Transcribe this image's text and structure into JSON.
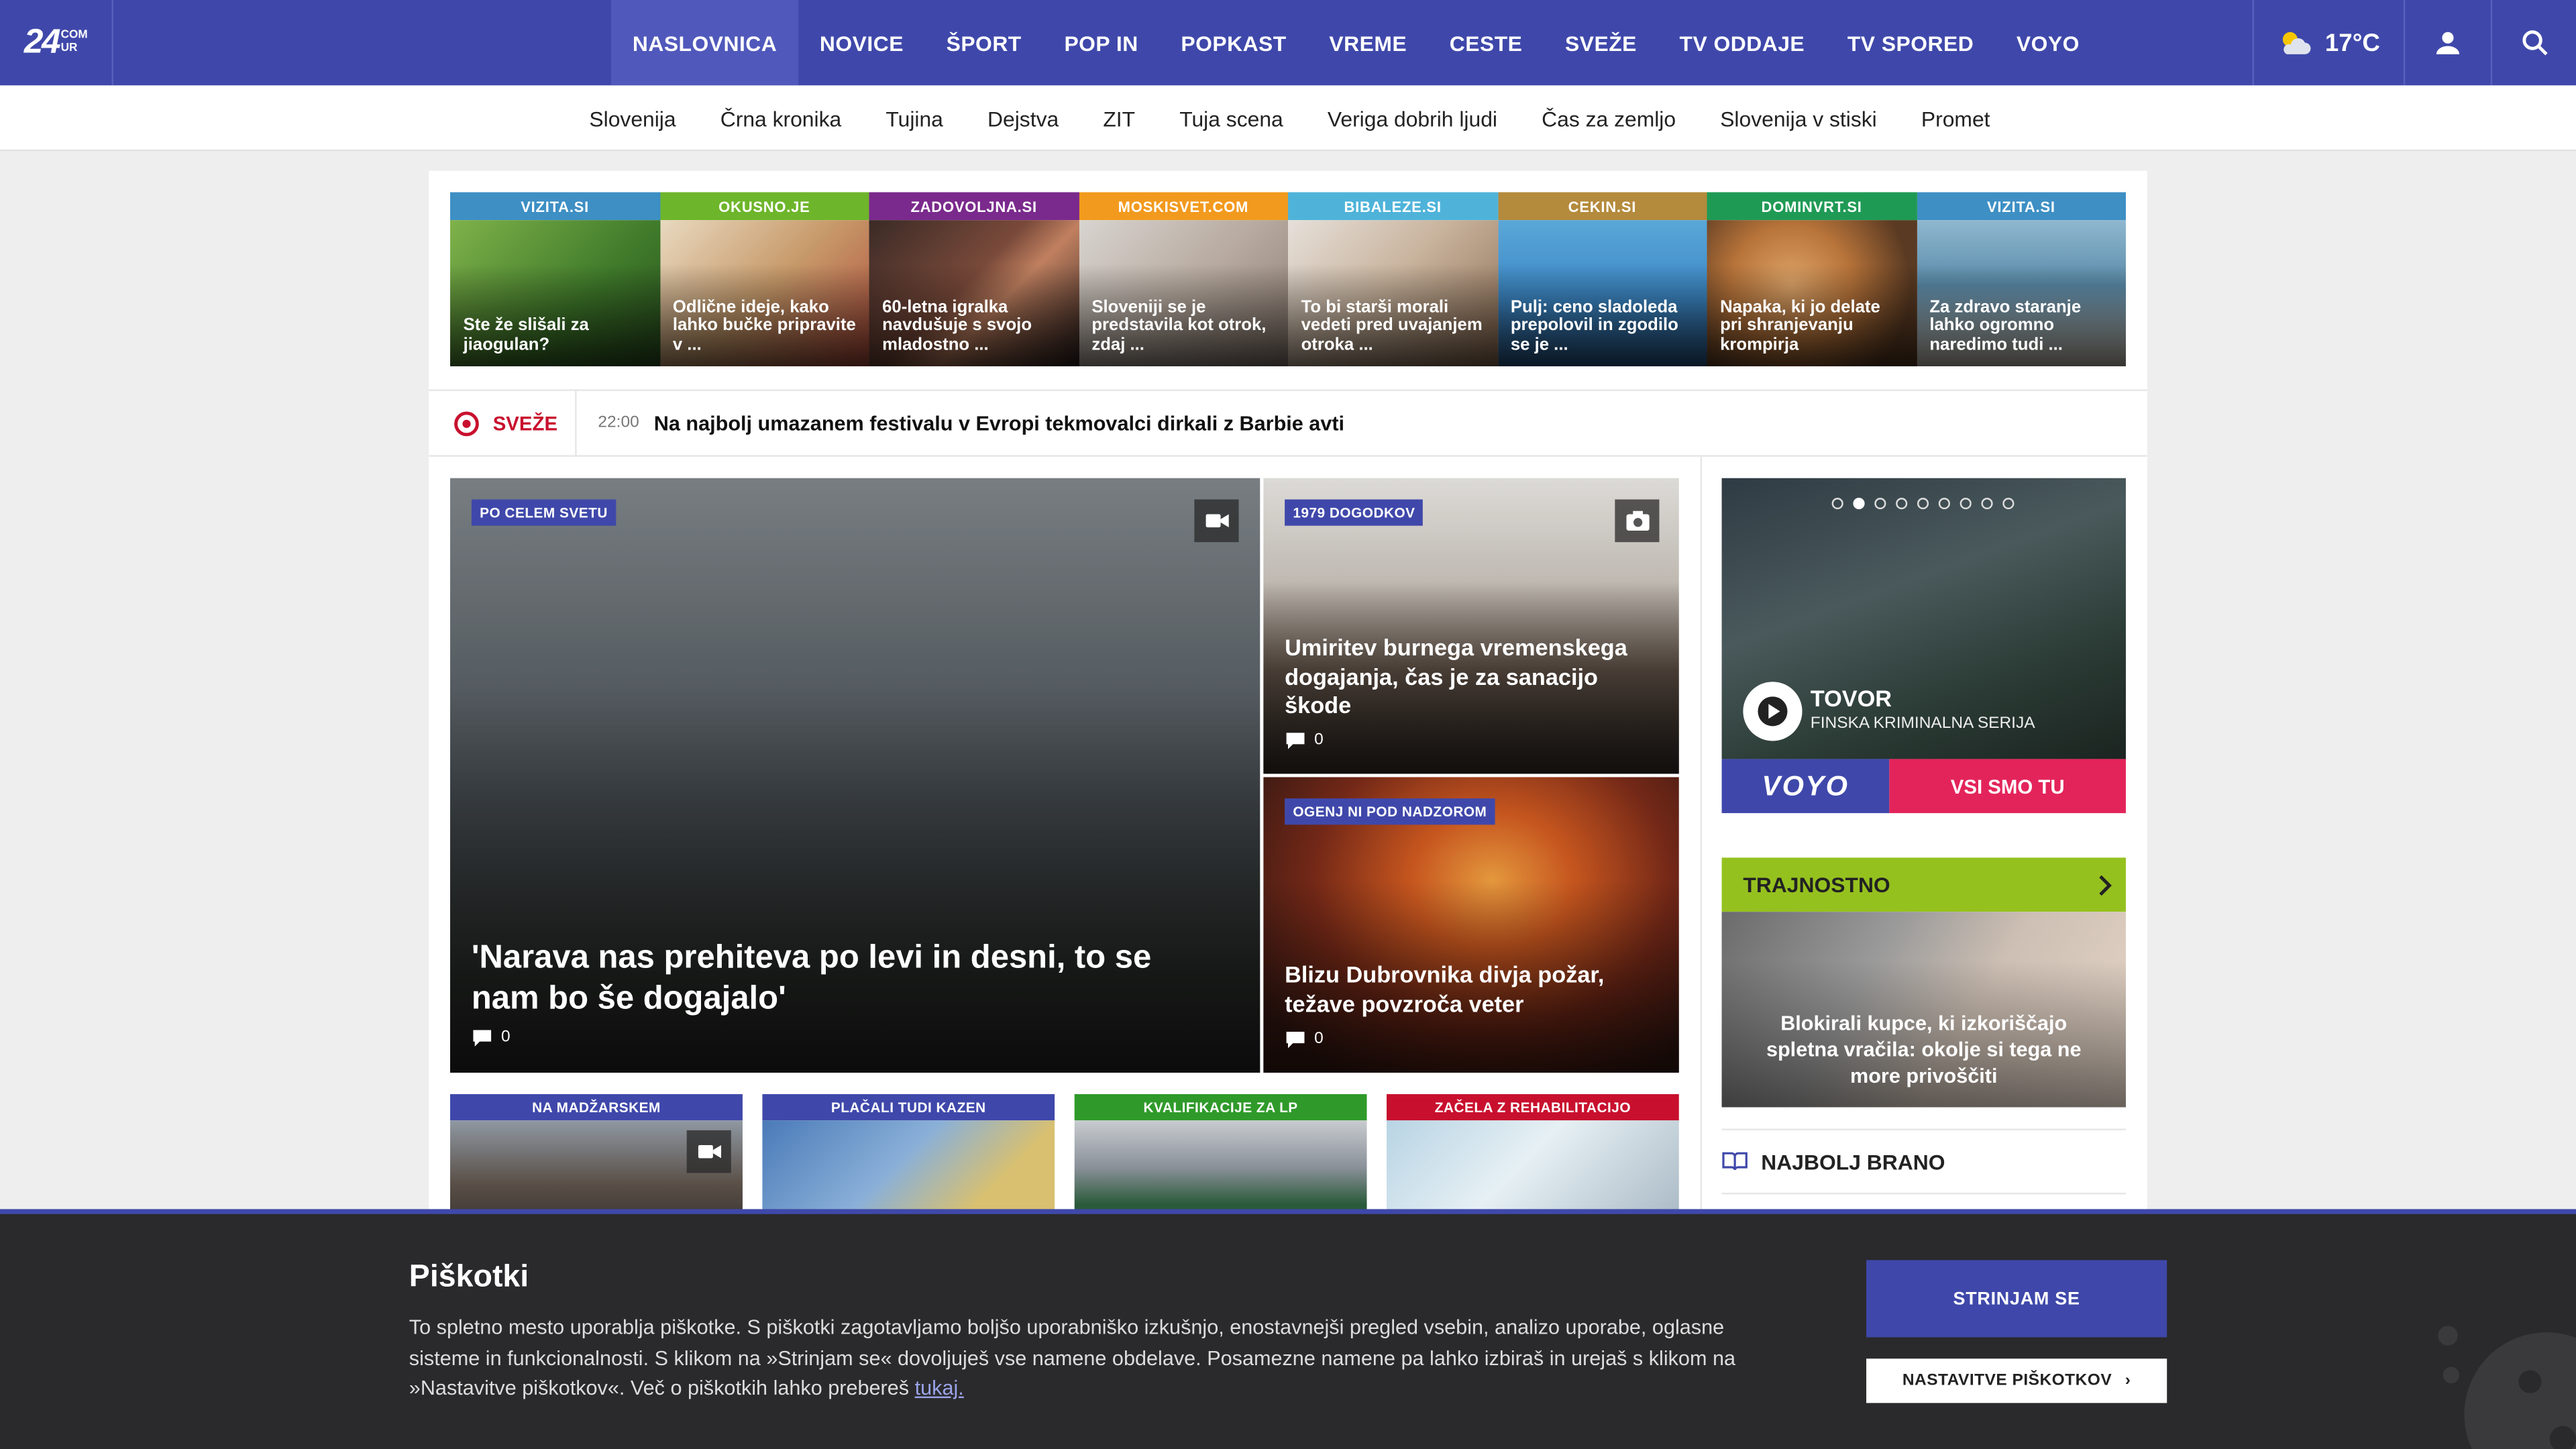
{
  "brand": {
    "logo_big": "24",
    "logo_small_top": "COM",
    "logo_small_bottom": "UR",
    "primary": "#3f48aa",
    "accent_red": "#c8102e",
    "voyo_pink": "#e3245a"
  },
  "main_nav": [
    {
      "label": "NASLOVNICA",
      "active": true
    },
    {
      "label": "NOVICE"
    },
    {
      "label": "ŠPORT"
    },
    {
      "label": "POP IN"
    },
    {
      "label": "POPKAST"
    },
    {
      "label": "VREME"
    },
    {
      "label": "CESTE"
    },
    {
      "label": "SVEŽE"
    },
    {
      "label": "TV ODDAJE"
    },
    {
      "label": "TV SPORED"
    },
    {
      "label": "VOYO"
    }
  ],
  "weather": {
    "temp": "17°C",
    "icon": "partly-cloudy-icon"
  },
  "sub_nav": [
    "Slovenija",
    "Črna kronika",
    "Tujina",
    "Dejstva",
    "ZIT",
    "Tuja scena",
    "Veriga dobrih ljudi",
    "Čas za zemljo",
    "Slovenija v stiski",
    "Promet"
  ],
  "partners": [
    {
      "tag": "VIZITA.SI",
      "color": "#3d8fc4",
      "title": "Ste že slišali za jiaogulan?"
    },
    {
      "tag": "OKUSNO.JE",
      "color": "#6db52a",
      "title": "Odlične ideje, kako lahko bučke pripravite v ..."
    },
    {
      "tag": "ZADOVOLJNA.SI",
      "color": "#7a2a8c",
      "title": "60-letna igralka navdušuje s svojo mladostno ..."
    },
    {
      "tag": "MOSKISVET.COM",
      "color": "#f29a1e",
      "title": "Sloveniji se je predstavila kot otrok, zdaj ..."
    },
    {
      "tag": "BIBALEZE.SI",
      "color": "#4fb3d9",
      "title": "To bi starši morali vedeti pred uvajanjem otroka ..."
    },
    {
      "tag": "CEKIN.SI",
      "color": "#b48a3c",
      "title": "Pulj: ceno sladoleda prepolovil in zgodilo se je ..."
    },
    {
      "tag": "DOMINVRT.SI",
      "color": "#1f9a55",
      "title": "Napaka, ki jo delate pri shranjevanju krompirja"
    },
    {
      "tag": "VIZITA.SI",
      "color": "#3d8fc4",
      "title": "Za zdravo staranje lahko ogromno naredimo tudi ..."
    }
  ],
  "ticker": {
    "label": "SVEŽE",
    "time": "22:00",
    "text": "Na najbolj umazanem festivalu v Evropi tekmovalci dirkali z Barbie avti"
  },
  "hero": {
    "tag": "PO CELEM SVETU",
    "title": "'Narava nas prehiteva po levi in desni, to se nam bo še dogajalo'",
    "comments": "0",
    "media": "video-icon"
  },
  "side_articles": [
    {
      "tag": "1979 DOGODKOV",
      "title": "Umiritev burnega vremenskega dogajanja, čas je za sanacijo škode",
      "comments": "0",
      "media": "camera-icon"
    },
    {
      "tag": "OGENJ NI POD NADZOROM",
      "title": "Blizu Dubrovnika divja požar, težave povzroča veter",
      "comments": "0"
    }
  ],
  "small_cards": [
    {
      "tag": "NA MADŽARSKEM",
      "color": "#3f48aa"
    },
    {
      "tag": "PLAČALI TUDI KAZEN",
      "color": "#3f48aa"
    },
    {
      "tag": "KVALIFIKACIJE ZA LP",
      "color": "#2f9a2a"
    },
    {
      "tag": "ZAČELA Z REHABILITACIJO",
      "color": "#c8102e"
    }
  ],
  "voyo": {
    "title": "TOVOR",
    "subtitle": "FINSKA KRIMINALNA SERIJA",
    "logo": "VOYO",
    "cta": "VSI SMO TU",
    "slides": 9,
    "active_slide": 2
  },
  "trajnostno": {
    "heading": "TRAJNOSTNO",
    "title": "Blokirali kupce, ki izkoriščajo spletna vračila: okolje si tega ne more privoščiti"
  },
  "najbolj": {
    "heading": "NAJBOLJ BRANO"
  },
  "cookie": {
    "title": "Piškotki",
    "text": "To spletno mesto uporablja piškotke. S piškotki zagotavljamo boljšo uporabniško izkušnjo, enostavnejši pregled vsebin, analizo uporabe, oglasne sisteme in funkcionalnosti. S klikom na »Strinjam se« dovoljuješ vse namene obdelave. Posamezne namene pa lahko izbiraš in urejaš s klikom na »Nastavitve piškotkov«. Več o piškotkih lahko prebereš ",
    "link": "tukaj.",
    "accept": "STRINJAM SE",
    "settings": "NASTAVITVE PIŠKOTKOV"
  }
}
